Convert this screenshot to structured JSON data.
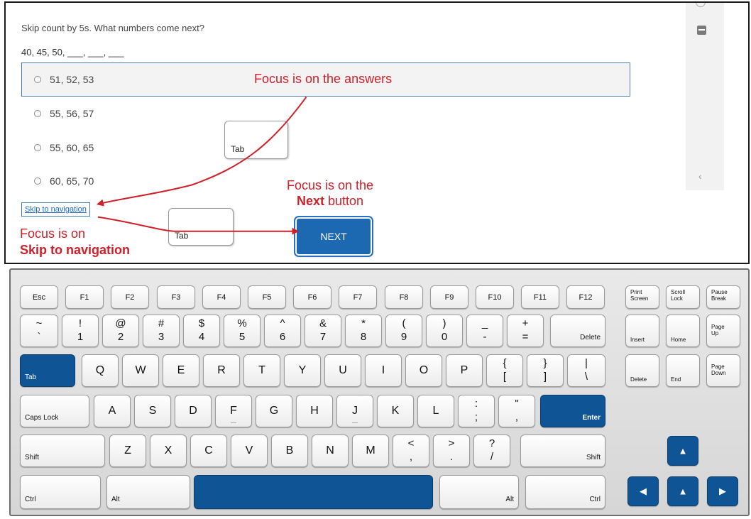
{
  "question": {
    "prompt": "Skip count by 5s. What numbers come next?",
    "sequence": "40, 45, 50, ___, ___, ___",
    "options": [
      "51, 52, 53",
      "55, 56, 57",
      "55, 60, 65",
      "60, 65, 70"
    ]
  },
  "annotations": {
    "focus_answers": "Focus is on the answers",
    "focus_next_line1": "Focus is on the",
    "focus_next_bold": "Next",
    "focus_next_rest": " button",
    "focus_skip_line1": "Focus is on",
    "focus_skip_bold": "Skip to navigation",
    "tab1": "Tab",
    "tab2": "Tab"
  },
  "nav": {
    "skip_link": "Skip to navigation",
    "next_button": "NEXT"
  },
  "colors": {
    "annotation": "#d0202a",
    "focus_ring": "#4e7ea8",
    "next": "#1c69b1",
    "active_key": "#0f5495"
  },
  "keyboard": {
    "highlighted_keys": [
      "Tab",
      "Enter",
      "Spacebar",
      "Up Arrow",
      "Left Arrow",
      "Up Arrow",
      "Right Arrow"
    ],
    "fn_row": [
      "Esc",
      "F1",
      "F2",
      "F3",
      "F4",
      "F5",
      "F6",
      "F7",
      "F8",
      "F9",
      "F10",
      "F11",
      "F12"
    ],
    "print_screen": [
      "Print",
      "Screen"
    ],
    "scroll_lock": [
      "Scroll",
      "Lock"
    ],
    "pause_break": [
      "Pause",
      "Break"
    ],
    "number_row": [
      {
        "t": "~",
        "b": "`"
      },
      {
        "t": "!",
        "b": "1"
      },
      {
        "t": "@",
        "b": "2"
      },
      {
        "t": "#",
        "b": "3"
      },
      {
        "t": "$",
        "b": "4"
      },
      {
        "t": "%",
        "b": "5"
      },
      {
        "t": "^",
        "b": "6"
      },
      {
        "t": "&",
        "b": "7"
      },
      {
        "t": "*",
        "b": "8"
      },
      {
        "t": "(",
        "b": "9"
      },
      {
        "t": ")",
        "b": "0"
      },
      {
        "t": "_",
        "b": "-"
      },
      {
        "t": "+",
        "b": "="
      }
    ],
    "delete_top": "Delete",
    "insert": "Insert",
    "home": "Home",
    "page_up": [
      "Page",
      "Up"
    ],
    "tab": "Tab",
    "row_q": [
      "Q",
      "W",
      "E",
      "R",
      "T",
      "Y",
      "U",
      "I",
      "O",
      "P"
    ],
    "row_q_sym": [
      {
        "t": "{",
        "b": "["
      },
      {
        "t": "}",
        "b": "]"
      },
      {
        "t": "|",
        "b": "\\"
      }
    ],
    "delete_nav": "Delete",
    "end": "End",
    "page_down": [
      "Page",
      "Down"
    ],
    "caps_lock": "Caps Lock",
    "row_a": [
      "A",
      "S",
      "D",
      "F",
      "G",
      "H",
      "J",
      "K",
      "L"
    ],
    "row_a_sym": [
      {
        "t": ":",
        "b": ";"
      },
      {
        "t": "\"",
        "b": ","
      }
    ],
    "enter": "Enter",
    "shift_left": "Shift",
    "row_z": [
      "Z",
      "X",
      "C",
      "V",
      "B",
      "N",
      "M"
    ],
    "row_z_sym": [
      {
        "t": "<",
        "b": ","
      },
      {
        "t": ">",
        "b": "."
      },
      {
        "t": "?",
        "b": "/"
      }
    ],
    "shift_right": "Shift",
    "ctrl_left": "Ctrl",
    "alt_left": "Alt",
    "alt_right": "Alt",
    "ctrl_right": "Ctrl",
    "arrow_up": "▲",
    "arrow_left": "◀",
    "arrow_down": "▲",
    "arrow_right": "▶"
  }
}
